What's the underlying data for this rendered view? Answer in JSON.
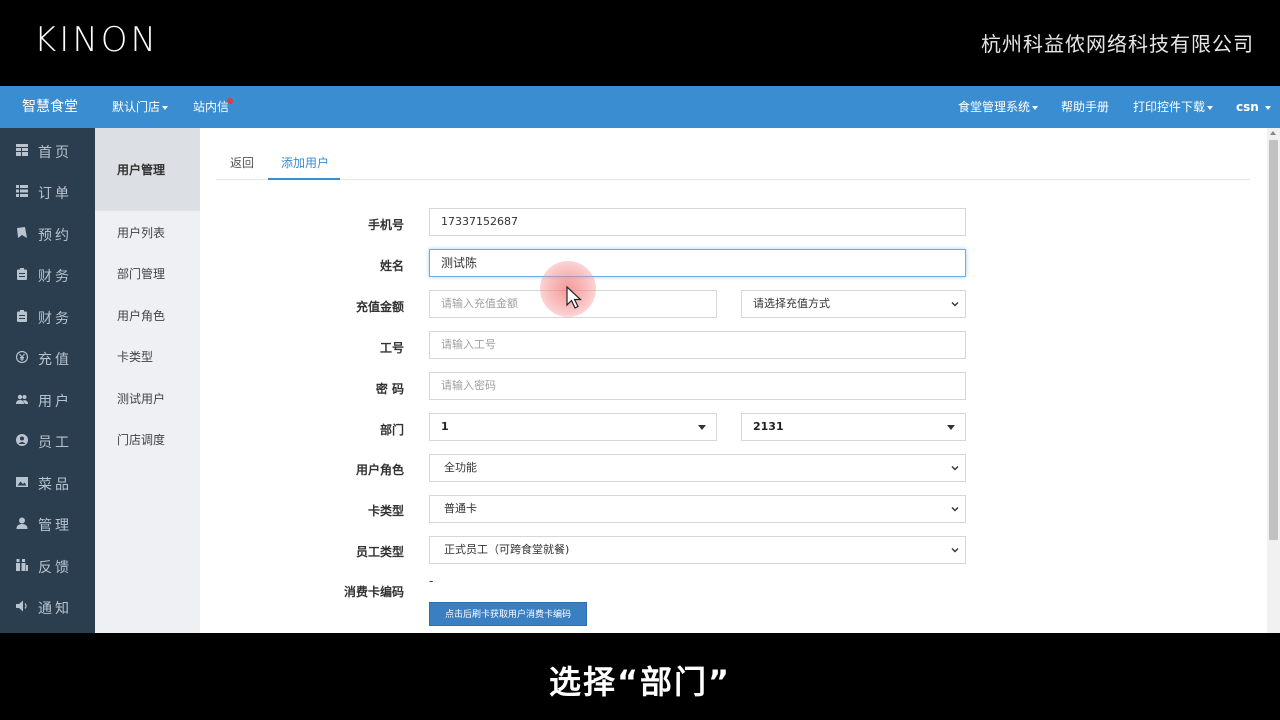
{
  "banner": {
    "logo": "KINON",
    "company": "杭州科益侬网络科技有限公司"
  },
  "navbar": {
    "brand": "智慧食堂",
    "store": "默认门店",
    "messages": "站内信",
    "system": "食堂管理系统",
    "help": "帮助手册",
    "print": "打印控件下载",
    "user": "csn",
    "accent_color": "#3a8dd0",
    "notification_color": "#e23b3b"
  },
  "sidebar": {
    "items": [
      {
        "label": "首页",
        "icon": "table-icon"
      },
      {
        "label": "订单",
        "icon": "list-icon"
      },
      {
        "label": "预约",
        "icon": "bookmark-icon"
      },
      {
        "label": "财务",
        "icon": "clipboard-icon"
      },
      {
        "label": "财务",
        "icon": "clipboard-icon"
      },
      {
        "label": "充值",
        "icon": "yen-icon"
      },
      {
        "label": "用户",
        "icon": "users-icon"
      },
      {
        "label": "员工",
        "icon": "user-circle-icon"
      },
      {
        "label": "菜品",
        "icon": "image-icon"
      },
      {
        "label": "管理",
        "icon": "user-icon"
      },
      {
        "label": "反馈",
        "icon": "feedback-icon"
      },
      {
        "label": "通知",
        "icon": "speaker-icon"
      }
    ],
    "background": "#2b3e50"
  },
  "subside": {
    "header": "用户管理",
    "items": [
      "用户列表",
      "部门管理",
      "用户角色",
      "卡类型",
      "测试用户",
      "门店调度"
    ]
  },
  "tabs": {
    "back": "返回",
    "add": "添加用户"
  },
  "form": {
    "phone_label": "手机号",
    "phone_value": "17337152687",
    "name_label": "姓名",
    "name_value": "测试陈",
    "recharge_label": "充值金额",
    "recharge_placeholder": "请输入充值金额",
    "recharge_method": "请选择充值方式",
    "job_label": "工号",
    "job_placeholder": "请输入工号",
    "password_label": "密 码",
    "password_placeholder": "请输入密码",
    "dept_label": "部门",
    "dept_value_1": "1",
    "dept_value_2": "2131",
    "role_label": "用户角色",
    "role_value": "全功能",
    "card_label": "卡类型",
    "card_value": "普通卡",
    "emp_type_label": "员工类型",
    "emp_type_value": "正式员工（可跨食堂就餐)",
    "card_code_label": "消费卡编码",
    "card_code_value": "-",
    "card_button": "点击后刷卡获取用户消费卡编码"
  },
  "caption": "选择“部门”"
}
